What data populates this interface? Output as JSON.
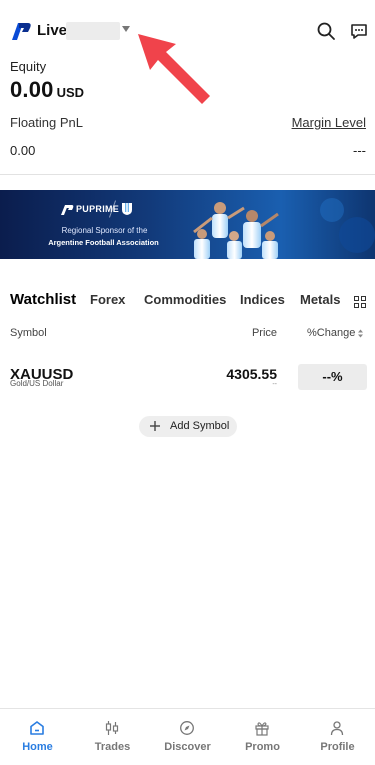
{
  "header": {
    "account_type": "Live",
    "search_icon": "search-icon",
    "chat_icon": "chat-icon"
  },
  "account": {
    "equity_label": "Equity",
    "equity_value": "0.00",
    "equity_currency": "USD",
    "floating_pnl_label": "Floating PnL",
    "floating_pnl_value": "0.00",
    "margin_level_label": "Margin Level",
    "margin_level_value": "---"
  },
  "banner": {
    "brand": "PUPRIME",
    "line1": "Regional Sponsor of the",
    "line2": "Argentine Football Association"
  },
  "tabs": [
    "Watchlist",
    "Forex",
    "Commodities",
    "Indices",
    "Metals"
  ],
  "table": {
    "col_symbol": "Symbol",
    "col_price": "Price",
    "col_change": "%Change",
    "rows": [
      {
        "symbol": "XAUUSD",
        "description": "Gold/US Dollar",
        "price": "4305.55",
        "sub": "--",
        "change": "--%"
      }
    ]
  },
  "add_symbol_label": "Add Symbol",
  "nav": {
    "items": [
      {
        "label": "Home",
        "icon": "home-icon"
      },
      {
        "label": "Trades",
        "icon": "trades-icon"
      },
      {
        "label": "Discover",
        "icon": "discover-icon"
      },
      {
        "label": "Promo",
        "icon": "promo-icon"
      },
      {
        "label": "Profile",
        "icon": "profile-icon"
      }
    ]
  },
  "colors": {
    "accent": "#2a7de1",
    "annotation_arrow": "#f0434b",
    "banner_bg": "#123a7a"
  }
}
